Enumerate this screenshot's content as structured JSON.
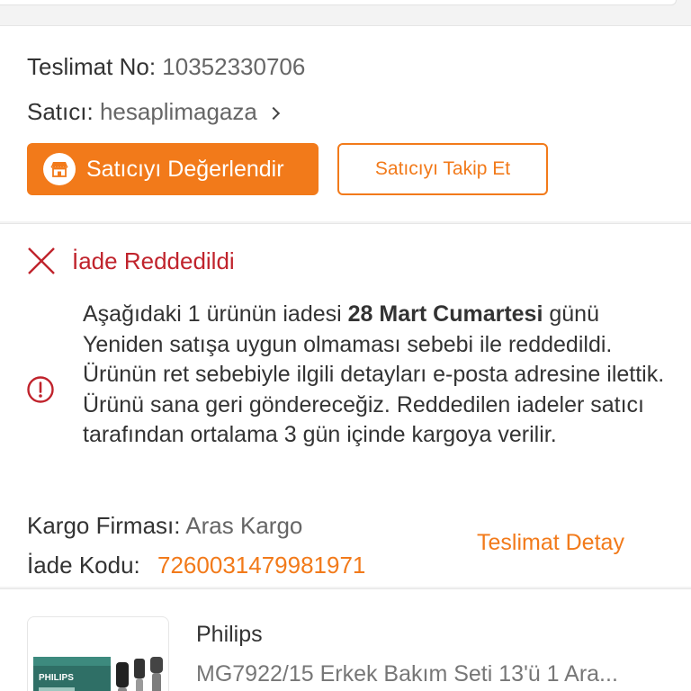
{
  "delivery": {
    "number_label": "Teslimat No:",
    "number_value": "10352330706",
    "seller_label": "Satıcı:",
    "seller_value": "hesaplimagaza"
  },
  "buttons": {
    "rate_seller": "Satıcıyı Değerlendir",
    "follow_seller": "Satıcıyı Takip Et"
  },
  "return": {
    "status_title": "İade Reddedildi",
    "notice_part1": "Aşağıdaki 1 ürünün iadesi ",
    "notice_date": "28 Mart Cumartesi",
    "notice_part2": " günü Yeniden satışa uygun olmaması sebebi ile reddedildi. Ürünün ret sebebiyle ilgili detayları e-posta adresine ilettik. Ürünü sana geri göndereceğiz. Reddedilen iadeler satıcı tarafından ortalama 3 gün içinde kargoya verilir.",
    "cargo_label": "Kargo Firması:",
    "cargo_value": "Aras Kargo",
    "code_label": "İade Kodu:",
    "code_value": "7260031479981971",
    "delivery_detail_link": "Teslimat Detay"
  },
  "product": {
    "brand": "Philips",
    "name": "MG7922/15 Erkek Bakım Seti 13'ü 1 Ara...",
    "image_brand_text": "PHILIPS"
  },
  "colors": {
    "accent": "#f27a1a",
    "error": "#c0232c"
  },
  "icons": {
    "store": "store-icon",
    "chevron": "chevron-right-icon",
    "reject": "close-x-icon",
    "info": "info-circle-icon"
  }
}
